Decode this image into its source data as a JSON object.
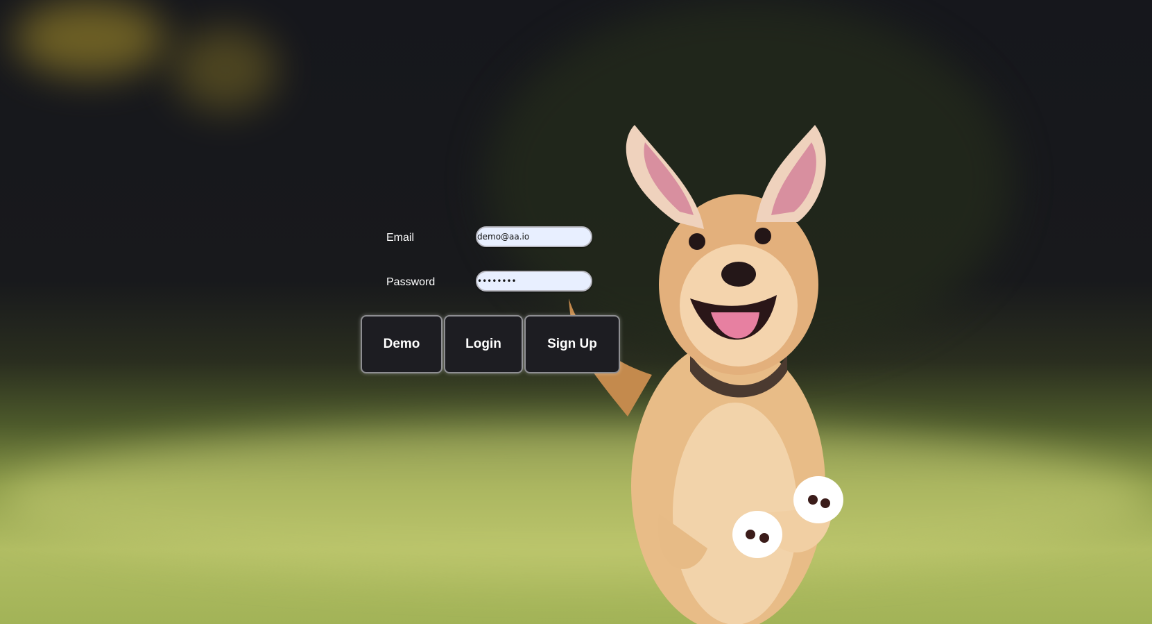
{
  "form": {
    "email_label": "Email",
    "email_value": "demo@aa.io",
    "password_label": "Password",
    "password_value": "••••••••"
  },
  "buttons": {
    "demo": "Demo",
    "login": "Login",
    "signup": "Sign Up"
  },
  "background": {
    "subject": "running-dog-photo",
    "top_color": "#16171c",
    "grass_color": "#a2b357"
  }
}
